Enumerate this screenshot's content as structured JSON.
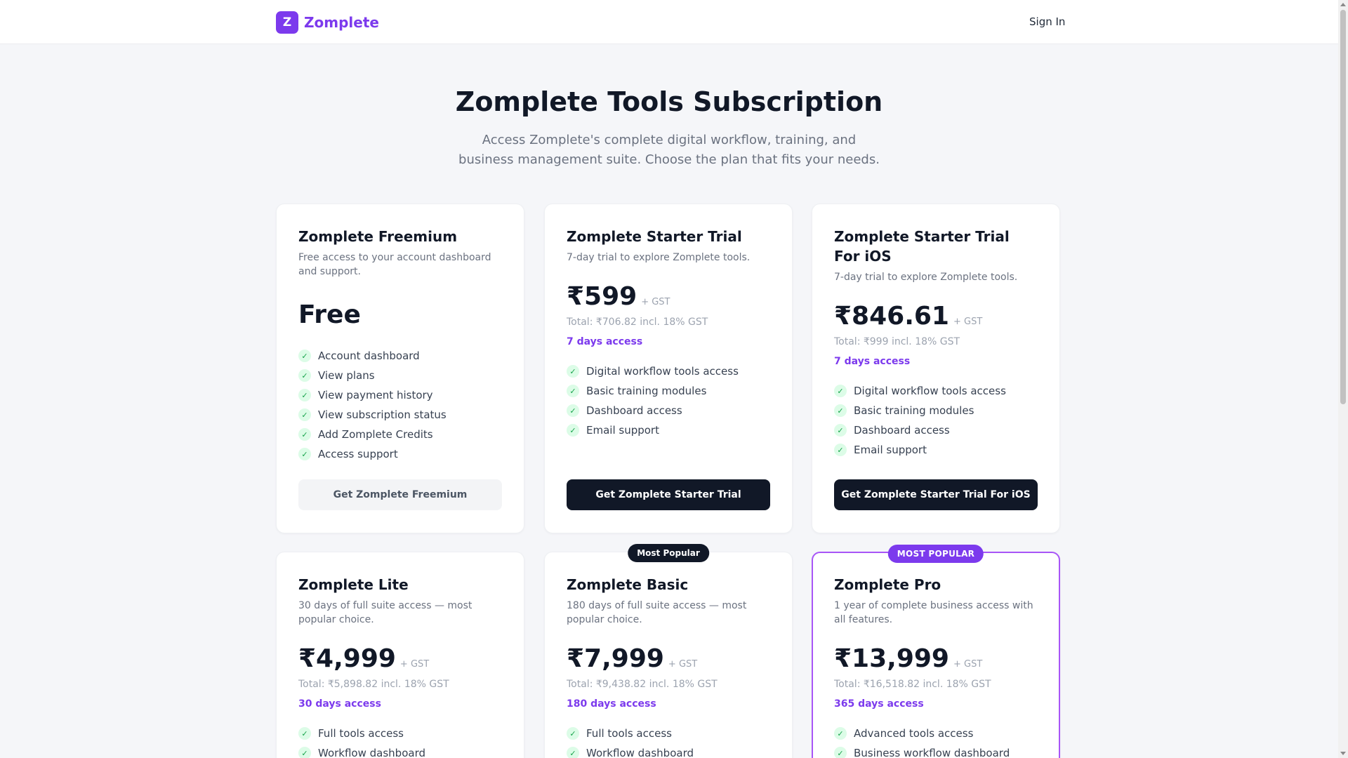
{
  "header": {
    "logo_letter": "Z",
    "logo_text": "Zomplete",
    "sign_in": "Sign In"
  },
  "hero": {
    "title": "Zomplete Tools Subscription",
    "subtitle": "Access Zomplete's complete digital workflow, training, and business management suite. Choose the plan that fits your needs."
  },
  "plans": [
    {
      "name": "Zomplete Freemium",
      "description": "Free access to your account dashboard and support.",
      "price": "Free",
      "features": [
        "Account dashboard",
        "View plans",
        "View payment history",
        "View subscription status",
        "Add Zomplete Credits",
        "Access support"
      ],
      "button": "Get Zomplete Freemium"
    },
    {
      "name": "Zomplete Starter Trial",
      "description": "7-day trial to explore Zomplete tools.",
      "price": "₹599",
      "gst": "+ GST",
      "total": "Total: ₹706.82 incl. 18% GST",
      "access": "7 days access",
      "features": [
        "Digital workflow tools access",
        "Basic training modules",
        "Dashboard access",
        "Email support"
      ],
      "button": "Get Zomplete Starter Trial"
    },
    {
      "name": "Zomplete Starter Trial For iOS",
      "description": "7-day trial to explore Zomplete tools.",
      "price": "₹846.61",
      "gst": "+ GST",
      "total": "Total: ₹999 incl. 18% GST",
      "access": "7 days access",
      "features": [
        "Digital workflow tools access",
        "Basic training modules",
        "Dashboard access",
        "Email support"
      ],
      "button": "Get Zomplete Starter Trial For iOS"
    },
    {
      "name": "Zomplete Lite",
      "description": "30 days of full suite access — most popular choice.",
      "price": "₹4,999",
      "gst": "+ GST",
      "total": "Total: ₹5,898.82 incl. 18% GST",
      "access": "30 days access",
      "features": [
        "Full tools access",
        "Workflow dashboard"
      ]
    },
    {
      "badge": "Most Popular",
      "name": "Zomplete Basic",
      "description": "180 days of full suite access — most popular choice.",
      "price": "₹7,999",
      "gst": "+ GST",
      "total": "Total: ₹9,438.82 incl. 18% GST",
      "access": "180 days access",
      "features": [
        "Full tools access",
        "Workflow dashboard"
      ]
    },
    {
      "badge": "MOST POPULAR",
      "name": "Zomplete Pro",
      "description": "1 year of complete business access with all features.",
      "price": "₹13,999",
      "gst": "+ GST",
      "total": "Total: ₹16,518.82 incl. 18% GST",
      "access": "365 days access",
      "features": [
        "Advanced tools access",
        "Business workflow dashboard"
      ]
    }
  ],
  "check_icon": "✓",
  "colors": {
    "brand": "#7c3aed",
    "dark_button": "#111827",
    "highlight_border": "#a855f7",
    "check_green": "#16a34a"
  }
}
